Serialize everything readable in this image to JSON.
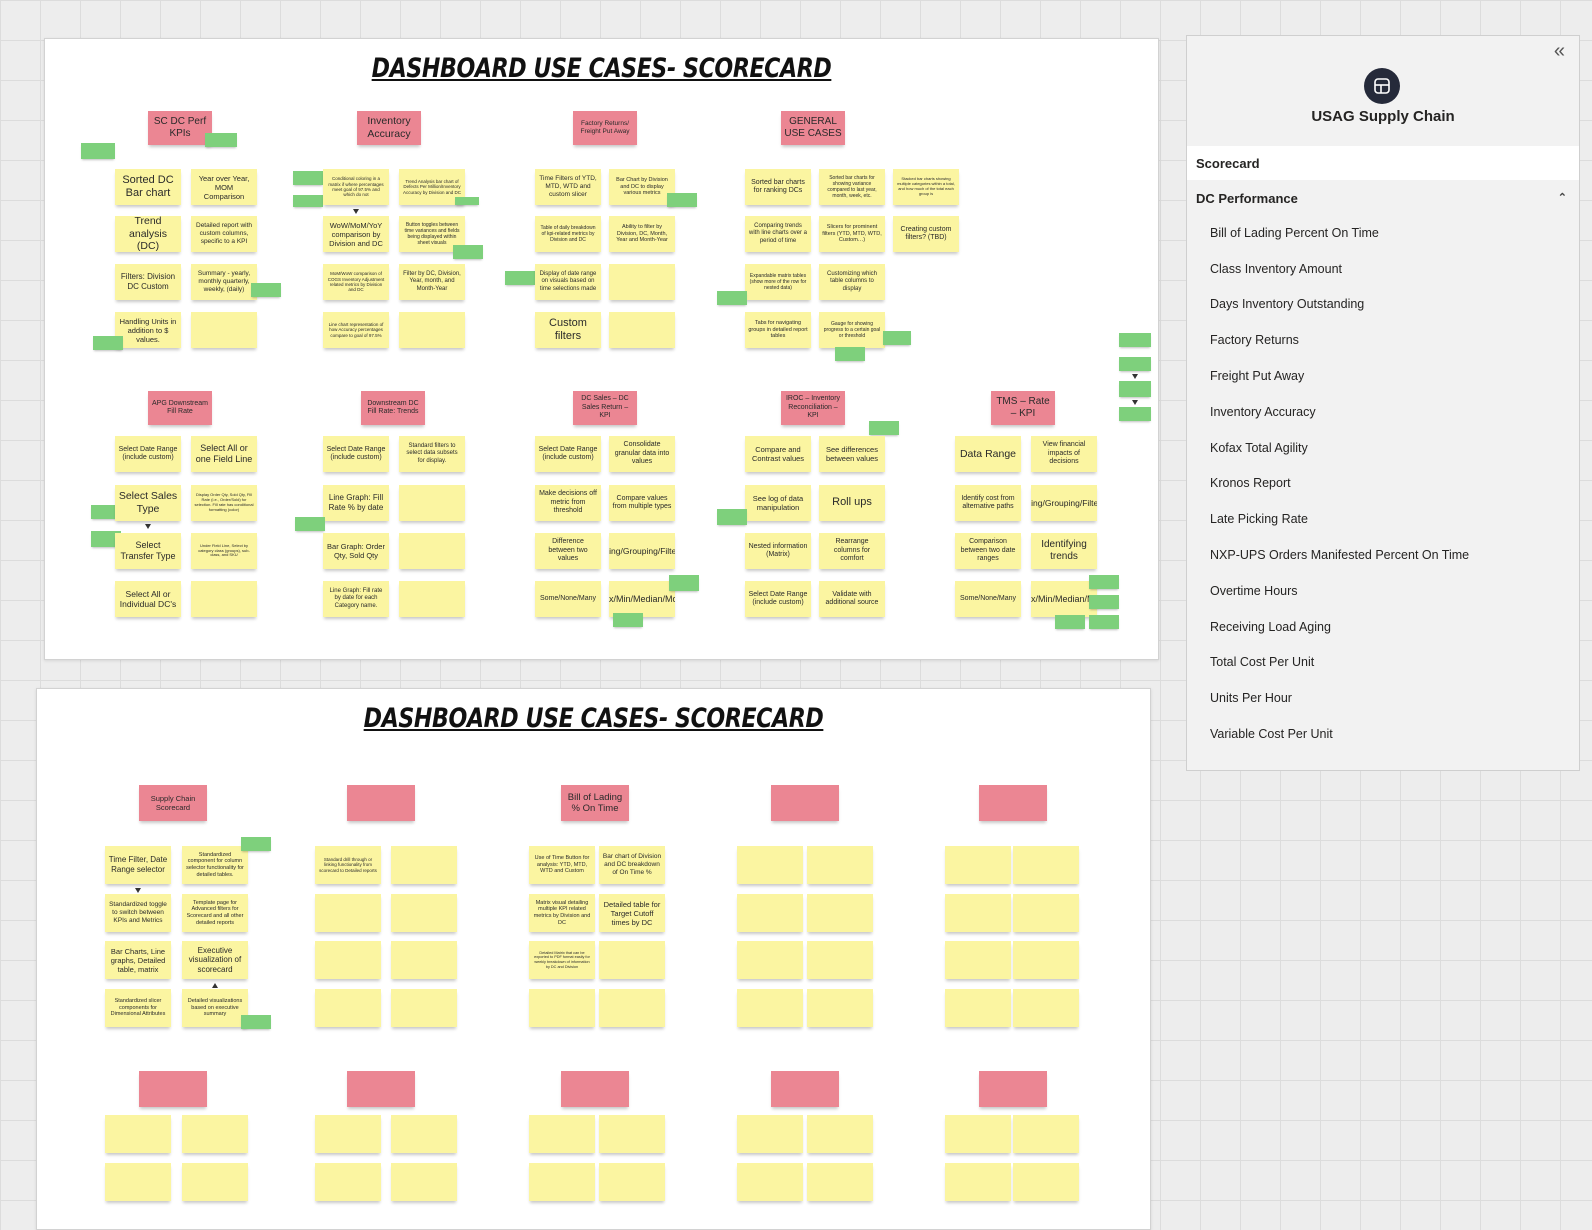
{
  "boards": [
    {
      "title": "DASHBOARD USE CASES- SCORECARD"
    },
    {
      "title": "DASHBOARD USE CASES- SCORECARD"
    }
  ],
  "notes": {
    "h_sc_dc_perf": "SC DC Perf KPIs",
    "h_inventory": "Inventory Accuracy",
    "h_factory": "Factory Returns/ Freight Put Away",
    "h_general": "GENERAL USE CASES",
    "h_apg": "APG Downstream Fill Rate",
    "h_downstream": "Downstream DC Fill Rate: Trends",
    "h_dc_sales": "DC Sales – DC Sales Return – KPI",
    "h_iroc": "IROC – Inventory Reconciliation – KPI",
    "h_tms": "TMS – Rate – KPI",
    "h_supply_chain": "Supply Chain Scorecard",
    "h_bill_lading": "Bill of Lading % On Time",
    "sc1": "Sorted DC Bar chart",
    "sc2": "Year over Year, MOM Comparison",
    "sc3": "Trend analysis (DC)",
    "sc4": "Detailed report with custom columns, specific to a KPI",
    "sc5": "Filters: Division DC Custom",
    "sc6": "Summary - yearly, monthly quarterly, weekly, (daily)",
    "sc7": "Handling Units in addition to $ values.",
    "ia1": "Conditional coloring in a matrix if where percentages meet goal of 97.5% and which do not",
    "ia2": "Trend Analysis bar chart of Defects Per Million/Inventory Accuracy by Division and DC",
    "ia3": "WoW/MoM/YoY comparison by Division and DC",
    "ia4": "Button toggles between time variances and fields being displayed within sheet visuals",
    "ia5": "MoM/WoW comparison of COGS Inventory Adjustment related metrics by Division and DC",
    "ia6": "Filter by DC, Division, Year, month, and Month-Year",
    "ia7": "Line chart representation of how Accuracy percentages compare to goal of 97.5%",
    "fr1": "Time Filters of YTD, MTD, WTD and custom slicer",
    "fr2": "Bar Chart by Division and DC to display various metrics",
    "fr3": "Table of daily breakdown of kpi-related metrics by Division and DC",
    "fr4": "Ability to filter by Division, DC, Month, Year and Month-Year",
    "fr5": "Display of date range on visuals based on time selections made",
    "fr6": "Custom filters",
    "gu1": "Sorted bar charts for ranking DCs",
    "gu2": "Sorted bar charts for showing variance compared to last year, month, week, etc.",
    "gu3": "Stacked bar charts showing multiple categories within a total, and how much of the total each group is",
    "gu4": "Comparing trends with line charts over a period of time",
    "gu5": "Slicers for prominent filters (YTD, MTD, WTD, Custom…)",
    "gu6": "Creating custom filters? (TBD)",
    "gu7": "Expandable matrix tables (show more of the row for nested data)",
    "gu8": "Customizing which table columns to display",
    "gu9": "Tabs for navigating groups in detailed report tables",
    "gu10": "Gauge for showing progress to a certain goal or threshold",
    "apg1": "Select Date Range (include custom)",
    "apg2": "Select All or one Field Line",
    "apg3": "Select Sales Type",
    "apg4": "Display Order Qty, Sold Qty, Fill Rate (i.e., Order/Sold) for selection. Fill rate has conditional formatting (color)",
    "apg5": "Select Transfer Type",
    "apg6": "Under Field Line, Select by category class (groups), sub-class, and SKU",
    "apg7": "Select All or Individual DC's",
    "dd1": "Select Date Range (include custom)",
    "dd2": "Standard filters to select data subsets for display.",
    "dd3": "Line Graph: Fill Rate % by date",
    "dd4": "Bar Graph: Order Qty, Sold Qty",
    "dd5": "Line Graph: Fill rate by date for each Category name.",
    "ds1": "Select Date Range (include custom)",
    "ds2": "Consolidate granular data into values",
    "ds3": "Make decisions off metric from threshold",
    "ds4": "Compare values from multiple types",
    "ds5": "Difference between two values",
    "ds6": "Sorting/Grouping/Filtering",
    "ds7": "Some/None/Many",
    "ds8": "Max/Min/Median/Mode",
    "ir1": "Compare and Contrast values",
    "ir2": "See differences between values",
    "ir3": "See log of data manipulation",
    "ir4": "Roll ups",
    "ir5": "Nested information (Matrix)",
    "ir6": "Rearrange columns for comfort",
    "ir7": "Select Date Range (include custom)",
    "ir8": "Validate with additional source",
    "tm1": "Data Range",
    "tm2": "View financial impacts of decisions",
    "tm3": "Identify cost from alternative paths",
    "tm4": "Sorting/Grouping/Filtering",
    "tm5": "Comparison between two date ranges",
    "tm6": "Identifying trends",
    "tm7": "Some/None/Many",
    "tm8": "Max/Min/Median/Mode",
    "sv1": "Time Filter, Date Range selector",
    "sv2": "Standardized component for column selector functionality for detailed tables.",
    "sv3": "Standardized toggle to switch between KPIs and Metrics",
    "sv4": "Template page for Advanced filters for Scorecard and all other detailed reports",
    "sv5": "Bar Charts, Line graphs, Detailed table, matrix",
    "sv6": "Executive visualization of scorecard",
    "sv7": "Standardized slicer components for Dimensional Attributes",
    "sv8": "Detailed visualizations based on executive summary",
    "b2c1": "Standard drill through or linking functionality from scorecard to Detailed reports",
    "bl1": "Use of Time Button for analysis: YTD, MTD, WTD and Custom",
    "bl2": "Bar chart of Division and DC breakdown of On Time %",
    "bl3": "Matrix visual detailing multiple KPI related metrics by Division and DC",
    "bl4": "Detailed table for Target Cutoff times by DC",
    "bl5": "Detailed Matrix that can be exported to PDF format easily for weekly breakdown of information by DC and Division"
  },
  "sidebar": {
    "collapse_icon": "«",
    "app_title": "USAG Supply Chain",
    "scorecard_label": "Scorecard",
    "section_label": "DC Performance",
    "items": [
      {
        "label": "Bill of Lading Percent On Time"
      },
      {
        "label": "Class Inventory Amount"
      },
      {
        "label": "Days Inventory Outstanding"
      },
      {
        "label": "Factory Returns"
      },
      {
        "label": "Freight Put Away"
      },
      {
        "label": "Inventory Accuracy"
      },
      {
        "label": "Kofax Total Agility"
      },
      {
        "label": "Kronos Report"
      },
      {
        "label": "Late Picking Rate"
      },
      {
        "label": "NXP-UPS Orders Manifested Percent On Time"
      },
      {
        "label": "Overtime Hours"
      },
      {
        "label": "Receiving Load Aging"
      },
      {
        "label": "Total Cost Per Unit"
      },
      {
        "label": "Units Per Hour"
      },
      {
        "label": "Variable Cost Per Unit"
      }
    ]
  },
  "colors": {
    "sticky_yellow": "#fbf5a1",
    "sticky_pink": "#eb8693",
    "sticky_green": "#7ed07c",
    "logo_bg": "#252a3a"
  }
}
